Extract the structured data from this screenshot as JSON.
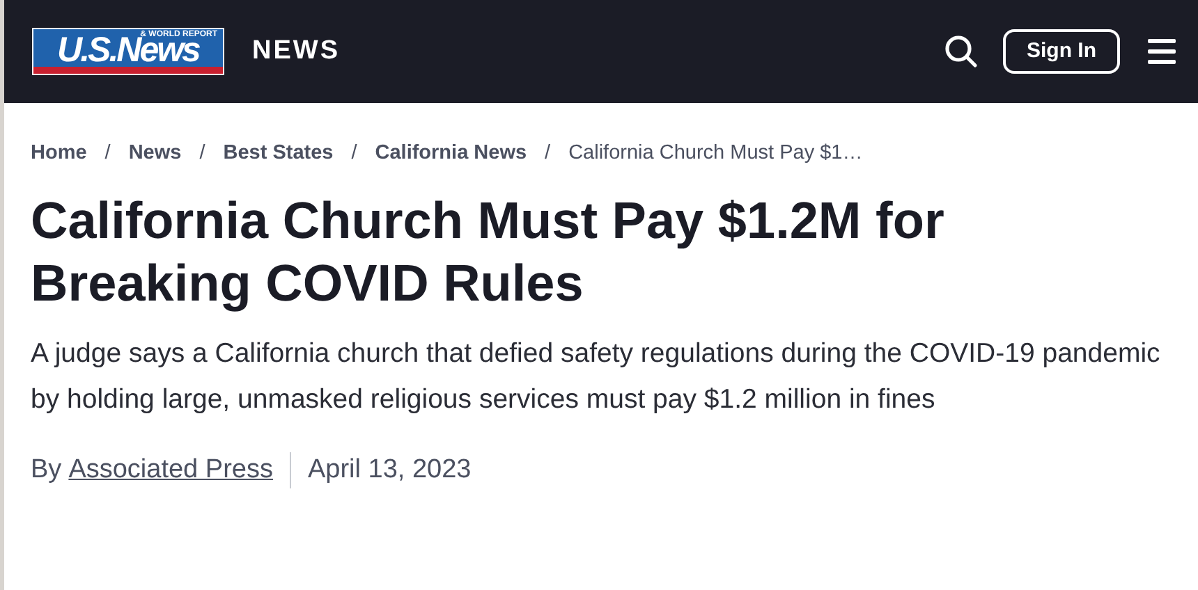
{
  "header": {
    "logo": {
      "main": "U.S.News",
      "sub": "& WORLD REPORT"
    },
    "section": "NEWS",
    "sign_in": "Sign In"
  },
  "breadcrumbs": [
    {
      "label": "Home",
      "kind": "link"
    },
    {
      "label": "News",
      "kind": "link"
    },
    {
      "label": "Best States",
      "kind": "link"
    },
    {
      "label": "California News",
      "kind": "link"
    },
    {
      "label": "California Church Must Pay $1…",
      "kind": "current"
    }
  ],
  "separator": "/",
  "article": {
    "title": "California Church Must Pay $1.2M for Breaking COVID Rules",
    "summary": "A judge says a California church that defied safety regulations during the COVID-19 pandemic by holding large, unmasked religious services must pay $1.2 million in fines",
    "byline_prefix": "By",
    "author": "Associated Press",
    "date": "April 13, 2023"
  }
}
